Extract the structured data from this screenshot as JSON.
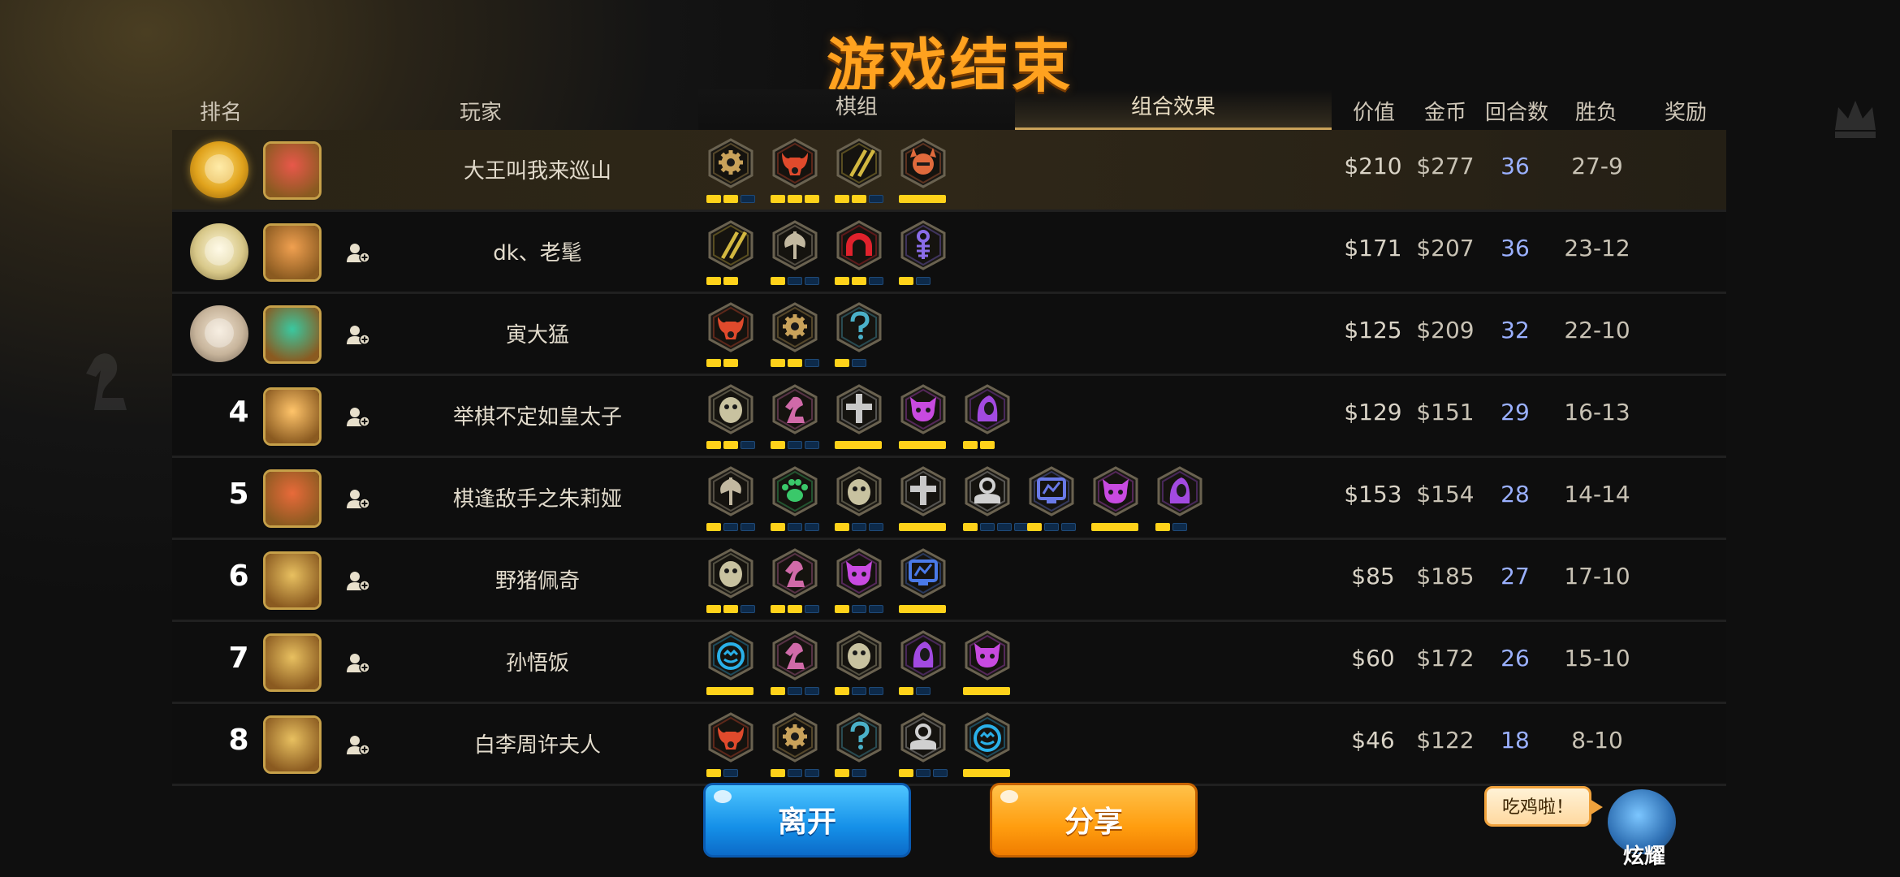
{
  "title": "游戏结束",
  "header": {
    "rank": "排名",
    "player": "玩家",
    "board_tab": "棋组",
    "combo_tab": "组合效果",
    "value": "价值",
    "gold": "金币",
    "rounds": "回合数",
    "win_loss": "胜负",
    "reward": "奖励"
  },
  "rows": [
    {
      "rank": "1",
      "medal": "gold",
      "avatar_color": "#e8584a",
      "name": "大王叫我来巡山",
      "value": "$210",
      "gold": "$277",
      "rounds": "36",
      "wl": "27-9",
      "pieces": [
        {
          "icon": "gear",
          "color": "#c9a25a",
          "bars": [
            2,
            3
          ]
        },
        {
          "icon": "bull",
          "color": "#e04a2c",
          "bars": [
            3,
            3
          ]
        },
        {
          "icon": "blades",
          "color": "#d3b840",
          "bars": [
            2,
            3
          ]
        },
        {
          "icon": "viking",
          "color": "#e06a3c",
          "bars": [
            1,
            1
          ]
        }
      ]
    },
    {
      "rank": "2",
      "medal": "silver",
      "avatar_color": "#f0a050",
      "name": "dk、老髦",
      "value": "$171",
      "gold": "$207",
      "rounds": "36",
      "wl": "23-12",
      "pieces": [
        {
          "icon": "blades",
          "color": "#d3b840",
          "bars": [
            2,
            2
          ]
        },
        {
          "icon": "axe",
          "color": "#c2b8a0",
          "bars": [
            1,
            3
          ]
        },
        {
          "icon": "arch",
          "color": "#e0222c",
          "bars": [
            2,
            3
          ]
        },
        {
          "icon": "fish",
          "color": "#8a6ce8",
          "bars": [
            1,
            2
          ]
        }
      ]
    },
    {
      "rank": "3",
      "medal": "bronze",
      "avatar_color": "#3ac8a0",
      "name": "寅大猛",
      "value": "$125",
      "gold": "$209",
      "rounds": "32",
      "wl": "22-10",
      "pieces": [
        {
          "icon": "bull",
          "color": "#e04a2c",
          "bars": [
            2,
            2
          ]
        },
        {
          "icon": "gear",
          "color": "#c9a25a",
          "bars": [
            2,
            3
          ]
        },
        {
          "icon": "mystery",
          "color": "#4ab0c8",
          "bars": [
            1,
            2
          ]
        }
      ]
    },
    {
      "rank": "4",
      "medal": "",
      "avatar_color": "#ffc46a",
      "name": "举棋不定如皇太子",
      "value": "$129",
      "gold": "$151",
      "rounds": "29",
      "wl": "16-13",
      "pieces": [
        {
          "icon": "egg",
          "color": "#c8c2a0",
          "bars": [
            2,
            3
          ]
        },
        {
          "icon": "knight",
          "color": "#d06aa8",
          "bars": [
            1,
            3
          ]
        },
        {
          "icon": "cross",
          "color": "#c8c8c8",
          "bars": [
            1,
            1
          ]
        },
        {
          "icon": "demon",
          "color": "#c84ae0",
          "bars": [
            1,
            1
          ]
        },
        {
          "icon": "hood",
          "color": "#a24ae0",
          "bars": [
            2,
            2
          ]
        }
      ]
    },
    {
      "rank": "5",
      "medal": "",
      "avatar_color": "#e86a3a",
      "name": "棋逢敌手之朱莉娅",
      "value": "$153",
      "gold": "$154",
      "rounds": "28",
      "wl": "14-14",
      "pieces": [
        {
          "icon": "axe",
          "color": "#c2b8a0",
          "bars": [
            1,
            3
          ]
        },
        {
          "icon": "paw",
          "color": "#3ac86a",
          "bars": [
            1,
            3
          ]
        },
        {
          "icon": "egg",
          "color": "#c8c2a0",
          "bars": [
            1,
            3
          ]
        },
        {
          "icon": "cross",
          "color": "#c8c8c8",
          "bars": [
            1,
            1
          ]
        },
        {
          "icon": "bust",
          "color": "#d0d0d0",
          "bars": [
            1,
            4
          ]
        },
        {
          "icon": "screen",
          "color": "#6a7ae8",
          "bars": [
            1,
            3
          ]
        },
        {
          "icon": "demon",
          "color": "#c84ae0",
          "bars": [
            1,
            1
          ]
        },
        {
          "icon": "hood",
          "color": "#a24ae0",
          "bars": [
            1,
            2
          ]
        }
      ]
    },
    {
      "rank": "6",
      "medal": "",
      "avatar_color": "#e8c060",
      "name": "野猪佩奇",
      "value": "$85",
      "gold": "$185",
      "rounds": "27",
      "wl": "17-10",
      "pieces": [
        {
          "icon": "egg",
          "color": "#c8c2a0",
          "bars": [
            2,
            3
          ]
        },
        {
          "icon": "knight",
          "color": "#d06aa8",
          "bars": [
            2,
            3
          ]
        },
        {
          "icon": "demon",
          "color": "#c84ae0",
          "bars": [
            1,
            3
          ]
        },
        {
          "icon": "screen",
          "color": "#4a7ae8",
          "bars": [
            1,
            1
          ]
        }
      ]
    },
    {
      "rank": "7",
      "medal": "",
      "avatar_color": "#e8c060",
      "name": "孙悟饭",
      "value": "$60",
      "gold": "$172",
      "rounds": "26",
      "wl": "15-10",
      "pieces": [
        {
          "icon": "pumpkin",
          "color": "#2ab0e8",
          "bars": [
            1,
            1
          ]
        },
        {
          "icon": "knight",
          "color": "#d06aa8",
          "bars": [
            1,
            3
          ]
        },
        {
          "icon": "egg",
          "color": "#c8c2a0",
          "bars": [
            1,
            3
          ]
        },
        {
          "icon": "hood",
          "color": "#a24ae0",
          "bars": [
            1,
            2
          ]
        },
        {
          "icon": "demon",
          "color": "#c84ae0",
          "bars": [
            1,
            1
          ]
        }
      ]
    },
    {
      "rank": "8",
      "medal": "",
      "avatar_color": "#e8c060",
      "name": "白李周许夫人",
      "value": "$46",
      "gold": "$122",
      "rounds": "18",
      "wl": "8-10",
      "pieces": [
        {
          "icon": "bull",
          "color": "#e04a2c",
          "bars": [
            1,
            2
          ]
        },
        {
          "icon": "gear",
          "color": "#c9a25a",
          "bars": [
            1,
            3
          ]
        },
        {
          "icon": "mystery",
          "color": "#4ab0c8",
          "bars": [
            1,
            2
          ]
        },
        {
          "icon": "bust",
          "color": "#d0d0d0",
          "bars": [
            1,
            3
          ]
        },
        {
          "icon": "pumpkin",
          "color": "#2ab0e8",
          "bars": [
            1,
            1
          ]
        }
      ]
    }
  ],
  "buttons": {
    "leave": "离开",
    "share": "分享"
  },
  "mascot": {
    "bubble": "吃鸡啦！",
    "label": "炫耀"
  },
  "colors": {
    "title": "#ffa21f",
    "accent_gold": "#c9a25a",
    "leave": "#1590e8",
    "share": "#ff9d0f",
    "rounds": "#9ab0ff"
  }
}
